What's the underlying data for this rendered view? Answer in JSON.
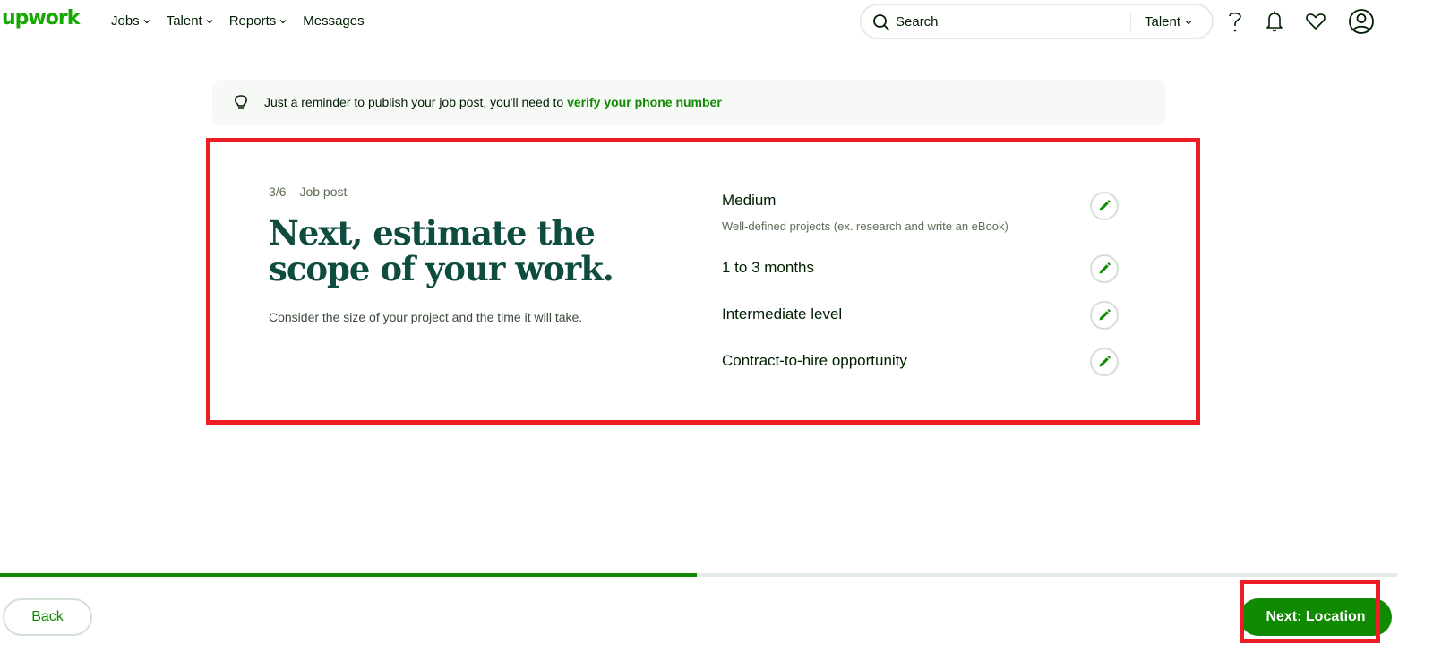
{
  "header": {
    "logo": "upwork",
    "nav": [
      {
        "label": "Jobs",
        "has_dropdown": true
      },
      {
        "label": "Talent",
        "has_dropdown": true
      },
      {
        "label": "Reports",
        "has_dropdown": true
      },
      {
        "label": "Messages",
        "has_dropdown": false
      }
    ],
    "search": {
      "placeholder": "Search",
      "scope": "Talent"
    },
    "icons": [
      "help-icon",
      "notifications-icon",
      "favorites-icon",
      "account-icon"
    ]
  },
  "banner": {
    "text": "Just a reminder to publish your job post, you'll need to ",
    "link": "verify your phone number"
  },
  "step": {
    "counter": "3/6",
    "label": "Job post",
    "title": "Next, estimate the scope of your work.",
    "subtitle": "Consider the size of your project and the time it will take."
  },
  "scope_items": [
    {
      "label": "Medium",
      "description": "Well-defined projects (ex. research and write an eBook)"
    },
    {
      "label": "1 to 3 months"
    },
    {
      "label": "Intermediate level"
    },
    {
      "label": "Contract-to-hire opportunity"
    }
  ],
  "progress": {
    "current_step": 3,
    "total_steps": 6,
    "fraction": 0.5
  },
  "footer": {
    "back_label": "Back",
    "next_label": "Next: Location"
  },
  "colors": {
    "brand": "#14a800",
    "accent": "#108a00",
    "title": "#0e4c3f",
    "highlight": "#ee1c25"
  }
}
